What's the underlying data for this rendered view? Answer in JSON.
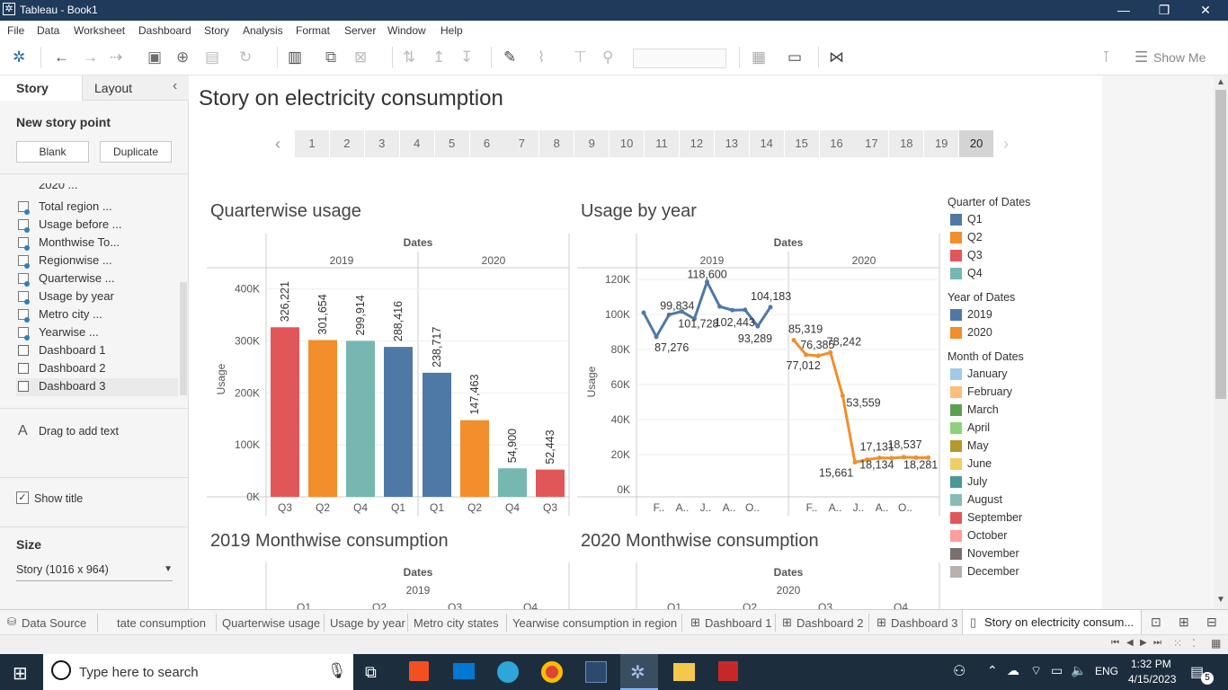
{
  "window": {
    "title": "Tableau - Book1"
  },
  "menu": [
    "File",
    "Data",
    "Worksheet",
    "Dashboard",
    "Story",
    "Analysis",
    "Format",
    "Server",
    "Window",
    "Help"
  ],
  "toolbar": {
    "show_me": "Show Me"
  },
  "left_panel": {
    "story_tab": "Story",
    "layout_tab": "Layout",
    "collapse_icon": "‹",
    "new_story_point": "New story point",
    "blank_button": "Blank",
    "duplicate_button": "Duplicate",
    "sheets": [
      {
        "label": "Total region ...",
        "type": "worksheet"
      },
      {
        "label": "Usage before ...",
        "type": "worksheet"
      },
      {
        "label": "Monthwise To...",
        "type": "worksheet"
      },
      {
        "label": "Regionwise ...",
        "type": "worksheet"
      },
      {
        "label": "Quarterwise ...",
        "type": "worksheet"
      },
      {
        "label": "Usage by year",
        "type": "worksheet"
      },
      {
        "label": "Metro city ...",
        "type": "worksheet"
      },
      {
        "label": "Yearwise ...",
        "type": "worksheet"
      },
      {
        "label": "Dashboard 1",
        "type": "dashboard"
      },
      {
        "label": "Dashboard 2",
        "type": "dashboard"
      },
      {
        "label": "Dashboard 3",
        "type": "dashboard"
      }
    ],
    "sheet_partial": "2020 ...",
    "drag_text": "Drag to add text",
    "show_title": "Show title",
    "size_label": "Size",
    "size_value": "Story (1016 x 964)"
  },
  "story": {
    "title": "Story on electricity consumption",
    "points": [
      "1",
      "2",
      "3",
      "4",
      "5",
      "6",
      "7",
      "8",
      "9",
      "10",
      "11",
      "12",
      "13",
      "14",
      "15",
      "16",
      "17",
      "18",
      "19",
      "20"
    ],
    "active_point": "20"
  },
  "charts": {
    "quarterwise": {
      "title": "Quarterwise usage",
      "dates_header": "Dates",
      "ylabel": "Usage",
      "years": [
        "2019",
        "2020"
      ]
    },
    "byyear": {
      "title": "Usage by year",
      "dates_header": "Dates",
      "ylabel": "Usage",
      "years": [
        "2019",
        "2020"
      ],
      "ticks_2019": [
        "F..",
        "A..",
        "J..",
        "A..",
        "O.."
      ],
      "ticks_2020": [
        "F..",
        "A..",
        "J..",
        "A..",
        "O.."
      ]
    },
    "m2019": {
      "title": "2019 Monthwise consumption",
      "dates_header": "Dates",
      "year": "2019",
      "quarters": [
        "Q1",
        "Q2",
        "Q3",
        "Q4"
      ]
    },
    "m2020": {
      "title": "2020 Monthwise consumption",
      "dates_header": "Dates",
      "year": "2020",
      "quarters": [
        "Q1",
        "Q2",
        "Q3",
        "Q4"
      ]
    }
  },
  "chart_data": [
    {
      "type": "bar",
      "title": "Quarterwise usage",
      "xlabel": "Dates",
      "ylabel": "Usage",
      "ylim": [
        0,
        420000
      ],
      "yticks": [
        "0K",
        "100K",
        "200K",
        "300K",
        "400K"
      ],
      "bars": [
        {
          "year": "2019",
          "quarter": "Q3",
          "value": 326221,
          "label": "326,221",
          "color": "#e15759"
        },
        {
          "year": "2019",
          "quarter": "Q2",
          "value": 301654,
          "label": "301,654",
          "color": "#f28e2b"
        },
        {
          "year": "2019",
          "quarter": "Q4",
          "value": 299914,
          "label": "299,914",
          "color": "#76b7b2"
        },
        {
          "year": "2019",
          "quarter": "Q1",
          "value": 288416,
          "label": "288,416",
          "color": "#4e79a7"
        },
        {
          "year": "2020",
          "quarter": "Q1",
          "value": 238717,
          "label": "238,717",
          "color": "#4e79a7"
        },
        {
          "year": "2020",
          "quarter": "Q2",
          "value": 147463,
          "label": "147,463",
          "color": "#f28e2b"
        },
        {
          "year": "2020",
          "quarter": "Q4",
          "value": 54900,
          "label": "54,900",
          "color": "#76b7b2"
        },
        {
          "year": "2020",
          "quarter": "Q3",
          "value": 52443,
          "label": "52,443",
          "color": "#e15759"
        }
      ]
    },
    {
      "type": "line",
      "title": "Usage by year",
      "xlabel": "Dates",
      "ylabel": "Usage",
      "ylim": [
        0,
        125000
      ],
      "yticks": [
        "0K",
        "20K",
        "40K",
        "60K",
        "80K",
        "100K",
        "120K"
      ],
      "series": [
        {
          "name": "2019",
          "color": "#4e79a7",
          "month_index": [
            1,
            2,
            3,
            4,
            5,
            6,
            7,
            8,
            9,
            10,
            11,
            12
          ],
          "values": [
            101000,
            87276,
            99834,
            101728,
            97500,
            118600,
            102443,
            104183,
            99000,
            93289,
            104183,
            0
          ],
          "points": [
            {
              "m": 1,
              "v": 101000
            },
            {
              "m": 2,
              "v": 87276
            },
            {
              "m": 3,
              "v": 99834
            },
            {
              "m": 4,
              "v": 101728
            },
            {
              "m": 5,
              "v": 97500
            },
            {
              "m": 6,
              "v": 118600
            },
            {
              "m": 7,
              "v": 104500
            },
            {
              "m": 8,
              "v": 102443
            },
            {
              "m": 9,
              "v": 102600
            },
            {
              "m": 10,
              "v": 93289
            },
            {
              "m": 11,
              "v": 104183
            }
          ],
          "labels": [
            {
              "m": 2,
              "text": "87,276"
            },
            {
              "m": 3,
              "text": "99,834"
            },
            {
              "m": 4,
              "text": "101,728"
            },
            {
              "m": 6,
              "text": "118,600"
            },
            {
              "m": 8,
              "text": "102,443"
            },
            {
              "m": 10,
              "text": "93,289"
            },
            {
              "m": 11,
              "text": "104,183"
            }
          ]
        },
        {
          "name": "2020",
          "color": "#f28e2b",
          "points": [
            {
              "m": 1,
              "v": 85319
            },
            {
              "m": 2,
              "v": 77012
            },
            {
              "m": 3,
              "v": 76385
            },
            {
              "m": 4,
              "v": 78242
            },
            {
              "m": 5,
              "v": 53559
            },
            {
              "m": 6,
              "v": 15661
            },
            {
              "m": 7,
              "v": 17131
            },
            {
              "m": 8,
              "v": 18134
            },
            {
              "m": 9,
              "v": 18000
            },
            {
              "m": 10,
              "v": 18537
            },
            {
              "m": 11,
              "v": 18281
            },
            {
              "m": 12,
              "v": 18281
            }
          ],
          "labels": [
            {
              "m": 1,
              "text": "85,319"
            },
            {
              "m": 2,
              "text": "77,012"
            },
            {
              "m": 3,
              "text": "76,385"
            },
            {
              "m": 4,
              "text": "78,242"
            },
            {
              "m": 5,
              "text": "53,559"
            },
            {
              "m": 6,
              "text": "15,661"
            },
            {
              "m": 7,
              "text": "17,131"
            },
            {
              "m": 8,
              "text": "18,134"
            },
            {
              "m": 10,
              "text": "18,537"
            },
            {
              "m": 11,
              "text": "18,281"
            }
          ]
        }
      ]
    }
  ],
  "legend": {
    "quarter_title": "Quarter of Dates",
    "quarters": [
      {
        "label": "Q1",
        "color": "#4e79a7"
      },
      {
        "label": "Q2",
        "color": "#f28e2b"
      },
      {
        "label": "Q3",
        "color": "#e15759"
      },
      {
        "label": "Q4",
        "color": "#76b7b2"
      }
    ],
    "year_title": "Year of Dates",
    "years": [
      {
        "label": "2019",
        "color": "#4e79a7"
      },
      {
        "label": "2020",
        "color": "#f28e2b"
      }
    ],
    "month_title": "Month of Dates",
    "months": [
      {
        "label": "January",
        "color": "#a0cbe8"
      },
      {
        "label": "February",
        "color": "#ffbe7d"
      },
      {
        "label": "March",
        "color": "#59a14f"
      },
      {
        "label": "April",
        "color": "#8cd17d"
      },
      {
        "label": "May",
        "color": "#b6992d"
      },
      {
        "label": "June",
        "color": "#f1ce63"
      },
      {
        "label": "July",
        "color": "#499894"
      },
      {
        "label": "August",
        "color": "#86bcb6"
      },
      {
        "label": "September",
        "color": "#e15759"
      },
      {
        "label": "October",
        "color": "#ff9d9a"
      },
      {
        "label": "November",
        "color": "#79706e"
      },
      {
        "label": "December",
        "color": "#bab0ac"
      }
    ]
  },
  "tabs": [
    "Data Source",
    "tate consumption",
    "Quarterwise usage",
    "Usage by year",
    "Metro city states",
    "Yearwise consumption in region",
    "Dashboard 1",
    "Dashboard 2",
    "Dashboard 3",
    "Story on electricity consum..."
  ],
  "taskbar": {
    "search_placeholder": "Type here to search",
    "time": "1:32 PM",
    "date": "4/15/2023",
    "lang": "ENG",
    "notif": "5"
  }
}
